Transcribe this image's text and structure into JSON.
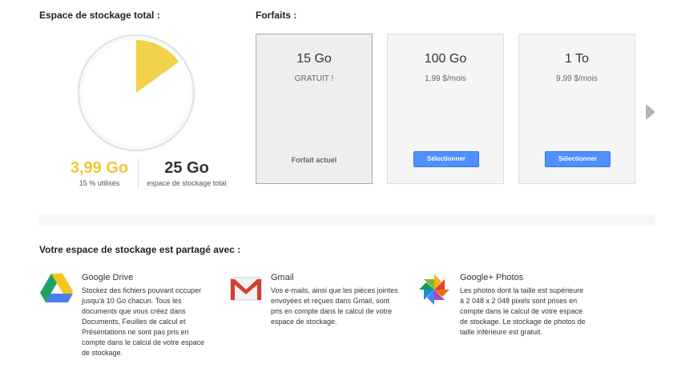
{
  "storage": {
    "title": "Espace de stockage total :",
    "used_value": "3,99 Go",
    "used_label": "15 % utilisés",
    "used_fraction": 0.15,
    "total_value": "25 Go",
    "total_label": "espace de stockage total",
    "used_color": "#f2d24b"
  },
  "plans": {
    "title": "Forfaits :",
    "items": [
      {
        "size": "15 Go",
        "price": "GRATUIT !",
        "action": "Forfait actuel"
      },
      {
        "size": "100 Go",
        "price": "1,99 $/mois",
        "action": "Sélectionner"
      },
      {
        "size": "1 To",
        "price": "9,99 $/mois",
        "action": "Sélectionner"
      }
    ]
  },
  "shared": {
    "title": "Votre espace de stockage est partagé avec :",
    "services": [
      {
        "name": "Google Drive",
        "icon": "google-drive-icon",
        "lines": [
          "Stockez des fichiers pouvant occuper",
          "jusqu'à 10 Go chacun. Tous les",
          "documents que vous créez dans",
          "Documents, Feuilles de calcul et",
          "Présentations ne sont pas pris en",
          "compte dans le calcul de votre espace",
          "de stockage."
        ]
      },
      {
        "name": "Gmail",
        "icon": "gmail-icon",
        "lines": [
          "Vos e-mails, ainsi que les pièces jointes",
          "envoyées et reçues dans Gmail, sont",
          "pris en compte dans le calcul de votre",
          "espace de stockage."
        ]
      },
      {
        "name": "Google+ Photos",
        "icon": "google-photos-icon",
        "lines": [
          "Les photos dont la taille est supérieure",
          "à 2 048 x 2 048 pixels sont prises en",
          "compte dans le calcul de votre espace",
          "de stockage. Le stockage de photos de",
          "taille inférieure est gratuit."
        ]
      }
    ]
  }
}
